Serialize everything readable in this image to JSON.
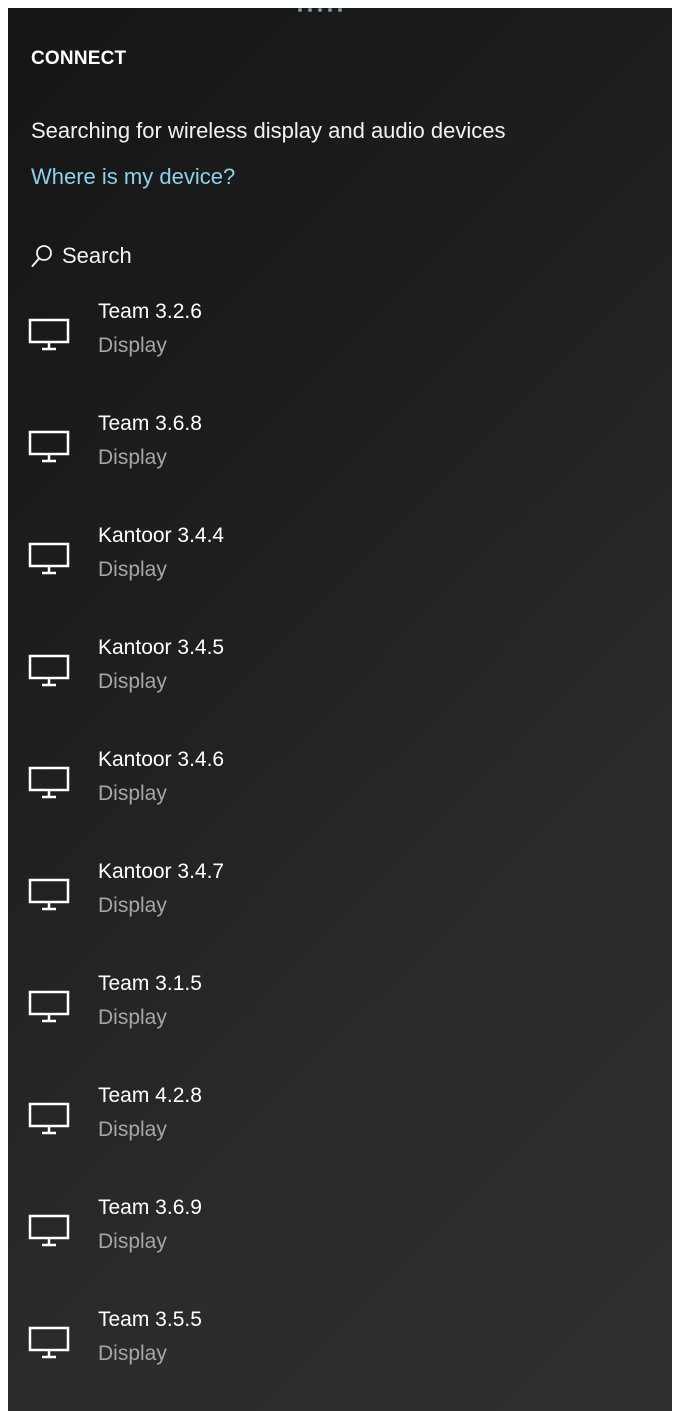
{
  "panel": {
    "title": "CONNECT",
    "status_text": "Searching for wireless display and audio devices",
    "help_link": "Where is my device?",
    "search_label": "Search"
  },
  "icons": {
    "search": "search-icon",
    "device": "monitor-icon"
  },
  "colors": {
    "background": "#1e1e1e",
    "link": "#8fd0ea",
    "secondary_text": "#a6a6a6",
    "progress_dots": "#7fb6cc"
  },
  "devices": [
    {
      "name": "Team 3.2.6",
      "type": "Display"
    },
    {
      "name": "Team 3.6.8",
      "type": "Display"
    },
    {
      "name": "Kantoor 3.4.4",
      "type": "Display"
    },
    {
      "name": "Kantoor 3.4.5",
      "type": "Display"
    },
    {
      "name": "Kantoor 3.4.6",
      "type": "Display"
    },
    {
      "name": "Kantoor 3.4.7",
      "type": "Display"
    },
    {
      "name": "Team 3.1.5",
      "type": "Display"
    },
    {
      "name": "Team 4.2.8",
      "type": "Display"
    },
    {
      "name": "Team 3.6.9",
      "type": "Display"
    },
    {
      "name": "Team 3.5.5",
      "type": "Display"
    }
  ]
}
